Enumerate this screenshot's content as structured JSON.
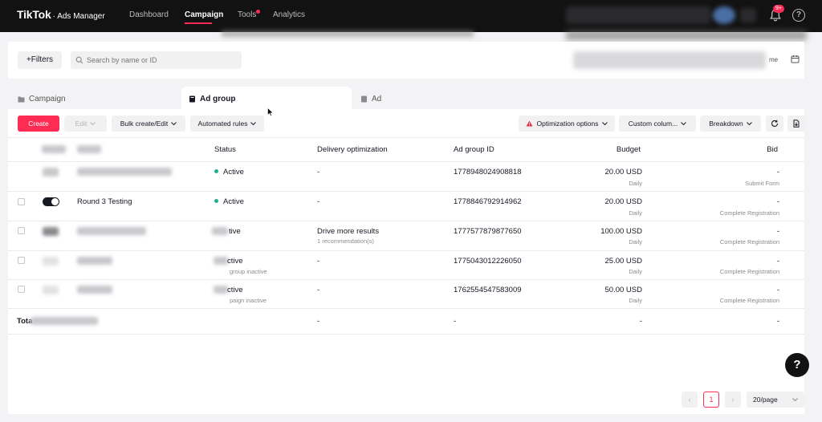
{
  "header": {
    "brand": "TikTok",
    "product": "· Ads Manager",
    "nav": [
      "Dashboard",
      "Campaign",
      "Tools",
      "Analytics"
    ],
    "notification_badge": "9+",
    "help": "?"
  },
  "filters": {
    "filters_label": "+Filters",
    "search_placeholder": "Search by name or ID",
    "date_tail": "me"
  },
  "tabs": [
    "Campaign",
    "Ad group",
    "Ad"
  ],
  "toolbar": {
    "create": "Create",
    "edit": "Edit",
    "bulk": "Bulk create/Edit",
    "rules": "Automated rules",
    "optimization": "Optimization options",
    "columns": "Custom colum...",
    "breakdown": "Breakdown"
  },
  "table": {
    "headers": [
      "Status",
      "Delivery optimization",
      "Ad group ID",
      "Budget",
      "Bid"
    ],
    "rows": [
      {
        "name": "",
        "status": "Active",
        "status_sub": "",
        "delivery": "-",
        "delivery_sub": "",
        "id": "1778948024908818",
        "budget": "20.00 USD",
        "budget_sub": "Daily",
        "bid": "-",
        "bid_sub": "Submit Form"
      },
      {
        "name": "Round 3 Testing",
        "status": "Active",
        "status_sub": "",
        "delivery": "-",
        "delivery_sub": "",
        "id": "1778846792914962",
        "budget": "20.00 USD",
        "budget_sub": "Daily",
        "bid": "-",
        "bid_sub": "Complete Registration"
      },
      {
        "name": "",
        "status": "tive",
        "status_sub": "",
        "delivery": "Drive more results",
        "delivery_sub": "1 recommendation(s)",
        "id": "1777577879877650",
        "budget": "100.00 USD",
        "budget_sub": "Daily",
        "bid": "-",
        "bid_sub": "Complete Registration"
      },
      {
        "name": "",
        "status": "ctive",
        "status_sub": "group inactive",
        "delivery": "-",
        "delivery_sub": "",
        "id": "1775043012226050",
        "budget": "25.00 USD",
        "budget_sub": "Daily",
        "bid": "-",
        "bid_sub": "Complete Registration"
      },
      {
        "name": "",
        "status": "ctive",
        "status_sub": "paign inactive",
        "delivery": "-",
        "delivery_sub": "",
        "id": "1762554547583009",
        "budget": "50.00 USD",
        "budget_sub": "Daily",
        "bid": "-",
        "bid_sub": "Complete Registration"
      }
    ],
    "total": {
      "label": "Tota",
      "delivery": "-",
      "id": "-",
      "budget": "-",
      "bid": "-"
    }
  },
  "pagination": {
    "prev": "‹",
    "current": "1",
    "next": "›",
    "page_size": "20/page"
  },
  "colors": {
    "accent": "#fe2c55",
    "active": "#1cb08c",
    "topbar": "#121212"
  }
}
